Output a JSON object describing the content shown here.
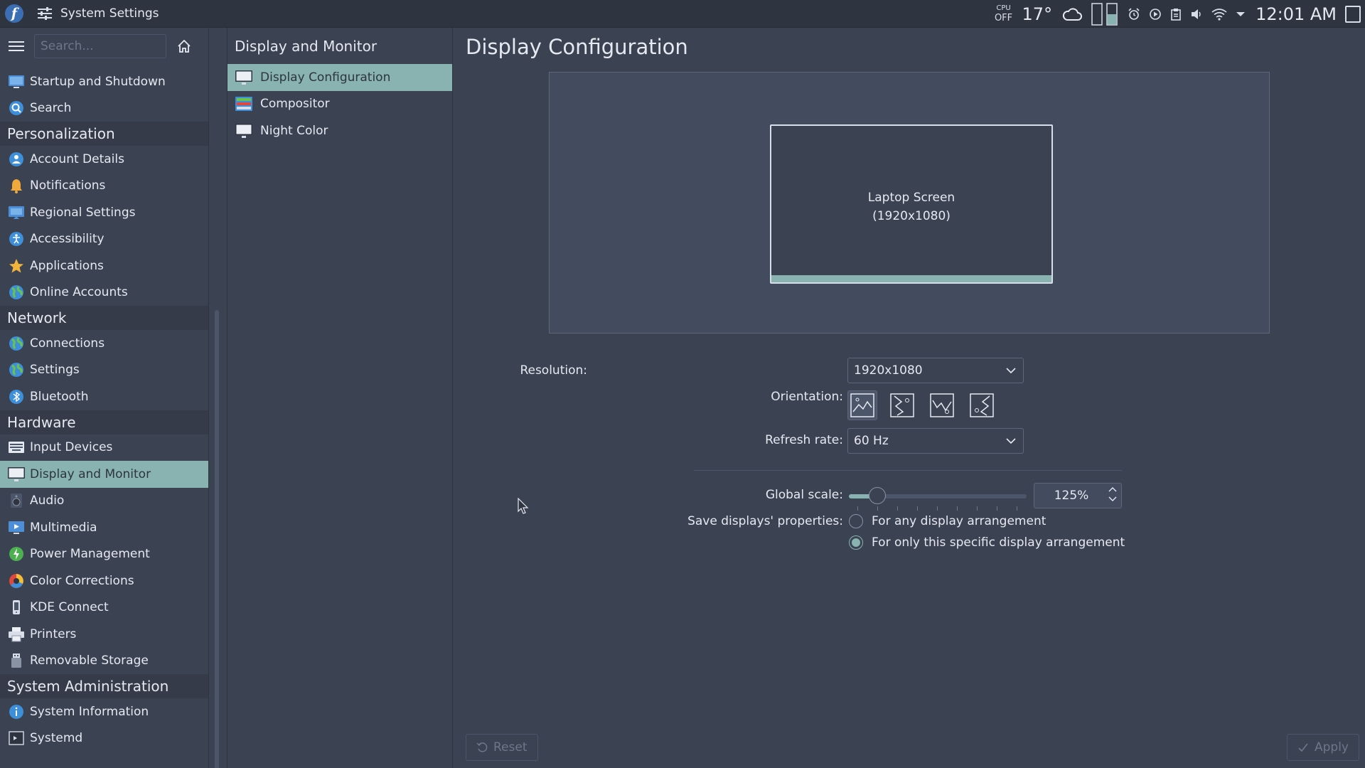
{
  "topbar": {
    "app_title": "System Settings",
    "cpu_label": "CPU",
    "cpu_status": "OFF",
    "temperature": "17°",
    "clock": "12:01 AM"
  },
  "sidebar": {
    "search_placeholder": "Search...",
    "entries": [
      {
        "type": "item",
        "label": "Startup and Shutdown",
        "icon": "startup-icon"
      },
      {
        "type": "item",
        "label": "Search",
        "icon": "search-icon"
      },
      {
        "type": "section",
        "label": "Personalization"
      },
      {
        "type": "item",
        "label": "Account Details",
        "icon": "account-icon"
      },
      {
        "type": "item",
        "label": "Notifications",
        "icon": "bell-icon"
      },
      {
        "type": "item",
        "label": "Regional Settings",
        "icon": "regional-icon"
      },
      {
        "type": "item",
        "label": "Accessibility",
        "icon": "accessibility-icon"
      },
      {
        "type": "item",
        "label": "Applications",
        "icon": "star-icon"
      },
      {
        "type": "item",
        "label": "Online Accounts",
        "icon": "globe-icon"
      },
      {
        "type": "section",
        "label": "Network"
      },
      {
        "type": "item",
        "label": "Connections",
        "icon": "globe-icon"
      },
      {
        "type": "item",
        "label": "Settings",
        "icon": "globe-icon"
      },
      {
        "type": "item",
        "label": "Bluetooth",
        "icon": "bluetooth-icon"
      },
      {
        "type": "section",
        "label": "Hardware"
      },
      {
        "type": "item",
        "label": "Input Devices",
        "icon": "keyboard-icon"
      },
      {
        "type": "item",
        "label": "Display and Monitor",
        "icon": "monitor-icon",
        "selected": true
      },
      {
        "type": "item",
        "label": "Audio",
        "icon": "speaker-icon"
      },
      {
        "type": "item",
        "label": "Multimedia",
        "icon": "multimedia-icon"
      },
      {
        "type": "item",
        "label": "Power Management",
        "icon": "power-icon"
      },
      {
        "type": "item",
        "label": "Color Corrections",
        "icon": "color-wheel-icon"
      },
      {
        "type": "item",
        "label": "KDE Connect",
        "icon": "phone-icon"
      },
      {
        "type": "item",
        "label": "Printers",
        "icon": "printer-icon"
      },
      {
        "type": "item",
        "label": "Removable Storage",
        "icon": "usb-icon"
      },
      {
        "type": "section",
        "label": "System Administration"
      },
      {
        "type": "item",
        "label": "System Information",
        "icon": "info-icon"
      },
      {
        "type": "item",
        "label": "Systemd",
        "icon": "terminal-icon"
      }
    ]
  },
  "midpanel": {
    "title": "Display and Monitor",
    "items": [
      {
        "label": "Display Configuration",
        "icon": "monitor-icon",
        "selected": true
      },
      {
        "label": "Compositor",
        "icon": "compositor-icon"
      },
      {
        "label": "Night Color",
        "icon": "monitor-icon"
      }
    ]
  },
  "main": {
    "title": "Display Configuration",
    "monitor_name": "Laptop Screen",
    "monitor_resolution": "(1920x1080)",
    "resolution_label": "Resolution:",
    "resolution_value": "1920x1080",
    "orientation_label": "Orientation:",
    "orientations": [
      "landscape",
      "portrait-left",
      "landscape-flipped",
      "portrait-right"
    ],
    "refresh_label": "Refresh rate:",
    "refresh_value": "60 Hz",
    "scale_label": "Global scale:",
    "scale_value": "125%",
    "scale_fraction": 0.16,
    "save_label": "Save displays' properties:",
    "save_options": [
      {
        "label": "For any display arrangement",
        "checked": false
      },
      {
        "label": "For only this specific display arrangement",
        "checked": true
      }
    ],
    "reset_label": "Reset",
    "apply_label": "Apply"
  },
  "colors": {
    "accent": "#88b3b0",
    "background": "#3b4252",
    "panel": "#2e3440"
  }
}
